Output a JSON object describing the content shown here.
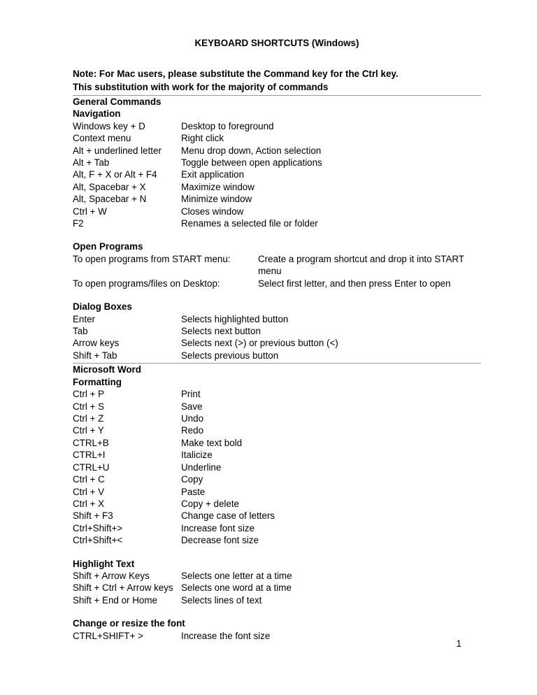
{
  "title": "KEYBOARD SHORTCUTS (Windows)",
  "note_line1": "Note: For Mac users, please substitute the Command key for the Ctrl key.",
  "note_line2": "This substitution with work for the majority of commands",
  "section1": {
    "h1": "General Commands",
    "h2": "Navigation",
    "rows": [
      {
        "k": "Windows key + D",
        "d": "Desktop to foreground"
      },
      {
        "k": "Context menu",
        "d": "Right click"
      },
      {
        "k": "Alt + underlined letter",
        "d": "Menu drop down, Action selection"
      },
      {
        "k": "Alt + Tab",
        "d": "Toggle between open applications"
      },
      {
        "k": "Alt, F + X  or Alt + F4",
        "d": "Exit application"
      },
      {
        "k": "Alt, Spacebar + X",
        "d": "Maximize window"
      },
      {
        "k": "Alt, Spacebar + N",
        "d": "Minimize window"
      },
      {
        "k": "Ctrl + W",
        "d": "Closes window"
      },
      {
        "k": "F2",
        "d": "Renames a selected file or folder"
      }
    ]
  },
  "section2": {
    "h1": "Open Programs",
    "rows": [
      {
        "k": "To open programs from START menu:",
        "d": "Create a program shortcut and drop it into START menu"
      },
      {
        "k": "To open programs/files on Desktop:",
        "d": "Select first letter, and then press Enter to open"
      }
    ]
  },
  "section3": {
    "h1": "Dialog Boxes",
    "rows": [
      {
        "k": "Enter",
        "d": "Selects highlighted button"
      },
      {
        "k": "Tab",
        "d": "Selects next button"
      },
      {
        "k": "Arrow keys",
        "d": "Selects next (>) or previous button (<)"
      },
      {
        "k": "Shift + Tab",
        "d": "Selects previous button"
      }
    ]
  },
  "section4": {
    "h1": "Microsoft Word",
    "h2": "Formatting",
    "rows": [
      {
        "k": "Ctrl + P",
        "d": "Print"
      },
      {
        "k": "Ctrl + S",
        "d": "Save"
      },
      {
        "k": "Ctrl + Z",
        "d": "Undo"
      },
      {
        "k": "Ctrl + Y",
        "d": "Redo"
      },
      {
        "k": "CTRL+B",
        "d": "Make text bold"
      },
      {
        "k": "CTRL+I",
        "d": "Italicize"
      },
      {
        "k": "CTRL+U",
        "d": "Underline"
      },
      {
        "k": "Ctrl + C",
        "d": "Copy"
      },
      {
        "k": "Ctrl + V",
        "d": "Paste"
      },
      {
        "k": "Ctrl + X",
        "d": "Copy + delete"
      },
      {
        "k": "Shift + F3",
        "d": "Change case of letters"
      },
      {
        "k": "Ctrl+Shift+>",
        "d": "Increase font size"
      },
      {
        "k": "Ctrl+Shift+<",
        "d": "Decrease font size"
      }
    ]
  },
  "section5": {
    "h1": "Highlight Text",
    "rows": [
      {
        "k": "Shift + Arrow Keys",
        "d": "Selects one letter at a time"
      },
      {
        "k": "Shift + Ctrl + Arrow keys",
        "d": "Selects one word at a time"
      },
      {
        "k": "Shift + End or Home",
        "d": "Selects lines of text"
      }
    ]
  },
  "section6": {
    "h1": "Change or resize the font",
    "rows": [
      {
        "k": "CTRL+SHIFT+ >",
        "d": "Increase the font size"
      }
    ]
  },
  "page_number": "1"
}
